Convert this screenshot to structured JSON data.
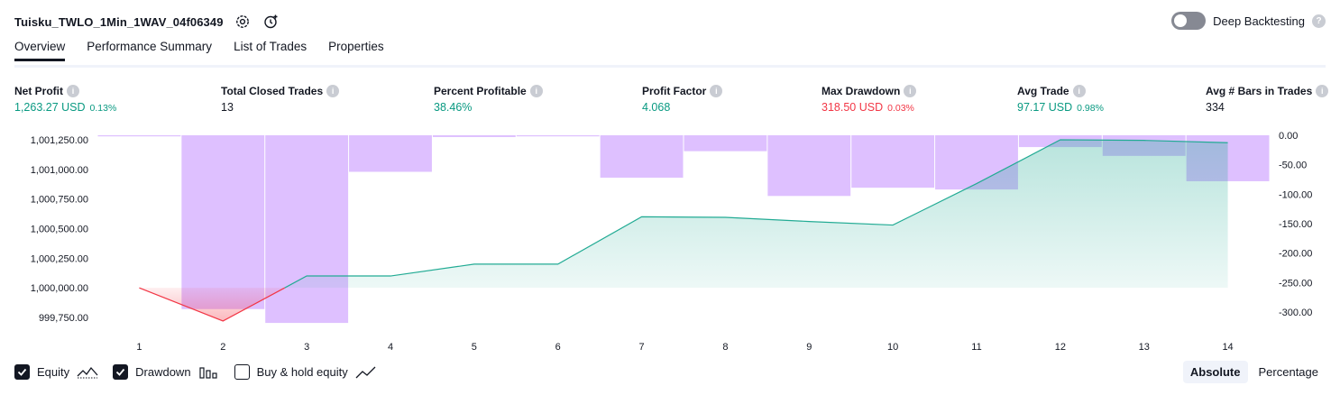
{
  "header": {
    "strategy_name": "Tuisku_TWLO_1Min_1WAV_04f06349",
    "deep_backtesting_label": "Deep Backtesting",
    "deep_backtesting_enabled": false
  },
  "tabs": [
    "Overview",
    "Performance Summary",
    "List of Trades",
    "Properties"
  ],
  "active_tab": "Overview",
  "metrics": [
    {
      "label": "Net Profit",
      "value": "1,263.27 USD",
      "pct": "0.13%",
      "color": "green"
    },
    {
      "label": "Total Closed Trades",
      "value": "13",
      "pct": "",
      "color": "dark"
    },
    {
      "label": "Percent Profitable",
      "value": "38.46%",
      "pct": "",
      "color": "green"
    },
    {
      "label": "Profit Factor",
      "value": "4.068",
      "pct": "",
      "color": "green"
    },
    {
      "label": "Max Drawdown",
      "value": "318.50 USD",
      "pct": "0.03%",
      "color": "red"
    },
    {
      "label": "Avg Trade",
      "value": "97.17 USD",
      "pct": "0.98%",
      "color": "green"
    },
    {
      "label": "Avg # Bars in Trades",
      "value": "334",
      "pct": "",
      "color": "dark"
    }
  ],
  "chart_data": {
    "type": "line",
    "x": [
      1,
      2,
      3,
      4,
      5,
      6,
      7,
      8,
      9,
      10,
      11,
      12,
      13,
      14
    ],
    "x_ticks": [
      "1",
      "2",
      "3",
      "4",
      "5",
      "6",
      "7",
      "8",
      "9",
      "10",
      "11",
      "12",
      "13",
      "14"
    ],
    "left_axis": {
      "ticks": [
        "1,001,250.00",
        "1,001,000.00",
        "1,000,750.00",
        "1,000,500.00",
        "1,000,250.00",
        "1,000,000.00",
        "999,750.00"
      ],
      "range": [
        999700,
        1001250
      ]
    },
    "right_axis": {
      "ticks": [
        "0.00",
        "-50.00",
        "-100.00",
        "-150.00",
        "-200.00",
        "-250.00",
        "-300.00"
      ],
      "range": [
        -320,
        0
      ]
    },
    "series": [
      {
        "name": "Equity",
        "axis": "left",
        "color": "#22ab94",
        "values": [
          1000000,
          999720,
          1000100,
          1000100,
          1000200,
          1000200,
          1000600,
          1000595,
          1000560,
          1000530,
          1000880,
          1001250,
          1001245,
          1001225
        ]
      },
      {
        "name": "Drawdown",
        "axis": "right",
        "color": "#d1a8ff",
        "values": [
          -1,
          -295,
          -318.5,
          -62,
          -3,
          -1,
          -72,
          -27,
          -103,
          -89,
          -92,
          -20,
          -35,
          -78
        ]
      }
    ],
    "baseline": 1000000,
    "grid": false
  },
  "legend": [
    {
      "label": "Equity",
      "checked": true,
      "icon": "equity-line-icon"
    },
    {
      "label": "Drawdown",
      "checked": true,
      "icon": "drawdown-bars-icon"
    },
    {
      "label": "Buy & hold equity",
      "checked": false,
      "icon": "buy-hold-line-icon"
    }
  ],
  "mode": {
    "options": [
      "Absolute",
      "Percentage"
    ],
    "active": "Absolute"
  }
}
